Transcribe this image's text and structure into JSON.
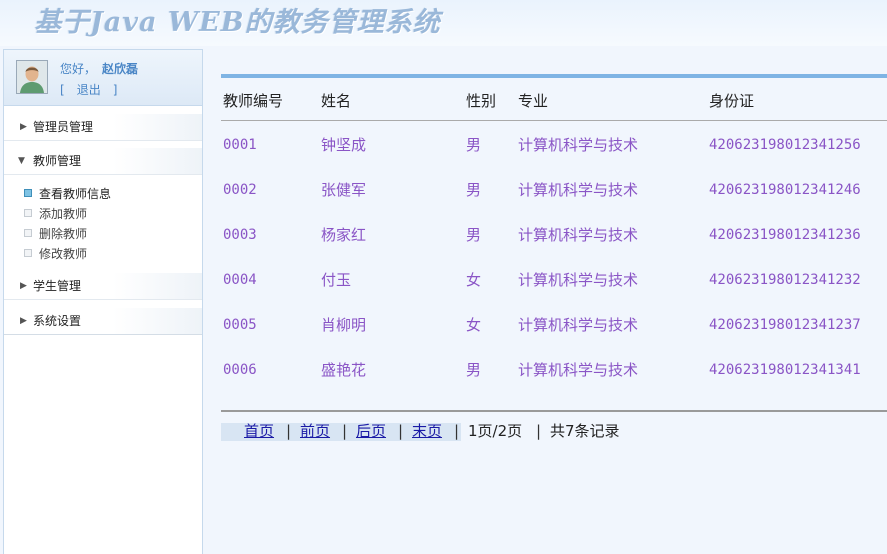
{
  "header": {
    "title": "基于Java WEB的教务管理系统"
  },
  "user": {
    "greeting": "您好，",
    "name": "赵欣磊",
    "logout_open": "[",
    "logout": "退出",
    "logout_close": "]"
  },
  "sidebar": {
    "menus": [
      {
        "label": "管理员管理",
        "expanded": false
      },
      {
        "label": "教师管理",
        "expanded": true,
        "items": [
          "查看教师信息",
          "添加教师",
          "删除教师",
          "修改教师"
        ],
        "active_index": 0
      },
      {
        "label": "学生管理",
        "expanded": false
      },
      {
        "label": "系统设置",
        "expanded": false
      }
    ]
  },
  "table": {
    "columns": [
      "教师编号",
      "姓名",
      "性别",
      "专业",
      "身份证"
    ],
    "rows": [
      [
        "0001",
        "钟坚成",
        "男",
        "计算机科学与技术",
        "420623198012341256"
      ],
      [
        "0002",
        "张健军",
        "男",
        "计算机科学与技术",
        "420623198012341246"
      ],
      [
        "0003",
        "杨家红",
        "男",
        "计算机科学与技术",
        "420623198012341236"
      ],
      [
        "0004",
        "付玉",
        "女",
        "计算机科学与技术",
        "420623198012341232"
      ],
      [
        "0005",
        "肖柳明",
        "女",
        "计算机科学与技术",
        "420623198012341237"
      ],
      [
        "0006",
        "盛艳花",
        "男",
        "计算机科学与技术",
        "420623198012341341"
      ]
    ]
  },
  "pager": {
    "first": "首页",
    "prev": "前页",
    "next": "后页",
    "last": "末页",
    "sep": "|",
    "page_info": "1页/2页",
    "total": "共7条记录"
  },
  "colors": {
    "accent": "#7fb4e4",
    "cell_text": "#8a55c6",
    "link": "#1a1aa6",
    "user_text": "#4a86c6"
  }
}
